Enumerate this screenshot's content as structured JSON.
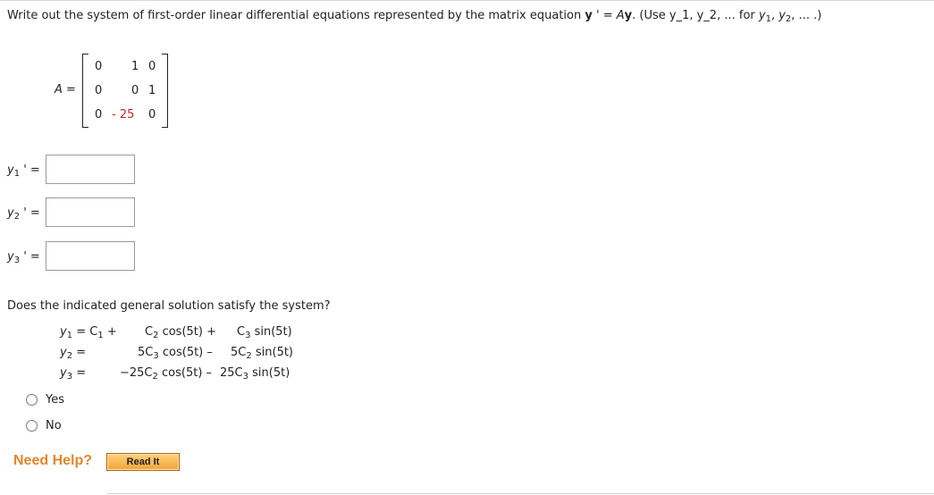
{
  "prompt": {
    "text_before": "Write out the system of first-order linear differential equations represented by the matrix equation ",
    "y_bold": "y",
    "prime_eq": " ' = ",
    "A": "A",
    "y_bold2": "y",
    "text_after": ". (Use y_1, y_2, ... for ",
    "y1": "y",
    "y1_sub": "1",
    "sep1": ", ",
    "y2": "y",
    "y2_sub": "2",
    "tail": ", ... .)"
  },
  "matrix": {
    "label": "A =",
    "rows": [
      [
        "0",
        "1",
        "0"
      ],
      [
        "0",
        "0",
        "1"
      ],
      [
        "0",
        "- 25",
        "0"
      ]
    ]
  },
  "answers": [
    {
      "var": "y",
      "sub": "1",
      "suffix": " ' =",
      "value": ""
    },
    {
      "var": "y",
      "sub": "2",
      "suffix": " ' =",
      "value": ""
    },
    {
      "var": "y",
      "sub": "3",
      "suffix": " ' =",
      "value": ""
    }
  ],
  "question2": "Does the indicated general solution satisfy the system?",
  "solution": {
    "y1_lhs": "y",
    "y1_sub": "1",
    "y1_eq": " = C",
    "y1_c_sub": "1",
    "y1_plus": " +",
    "y1_t1": "C",
    "y1_t1_sub": "2",
    "y1_t1_rest": " cos(5t) +",
    "y1_t2": "C",
    "y1_t2_sub": "3",
    "y1_t2_rest": " sin(5t)",
    "y2_lhs": "y",
    "y2_sub": "2",
    "y2_eq": " =",
    "y2_t1": "5C",
    "y2_t1_sub": "3",
    "y2_t1_rest": " cos(5t) –",
    "y2_t2": "5C",
    "y2_t2_sub": "2",
    "y2_t2_rest": " sin(5t)",
    "y3_lhs": "y",
    "y3_sub": "3",
    "y3_eq": " =",
    "y3_t1": "−25C",
    "y3_t1_sub": "2",
    "y3_t1_rest": " cos(5t) –",
    "y3_t2": "25C",
    "y3_t2_sub": "3",
    "y3_t2_rest": " sin(5t)"
  },
  "options": [
    {
      "label": "Yes",
      "selected": false
    },
    {
      "label": "No",
      "selected": false
    }
  ],
  "help": {
    "need_help": "Need Help?",
    "read_it": "Read It"
  },
  "colors": {
    "accent_orange": "#e4862b",
    "matrix_highlight": "#cc2222"
  }
}
